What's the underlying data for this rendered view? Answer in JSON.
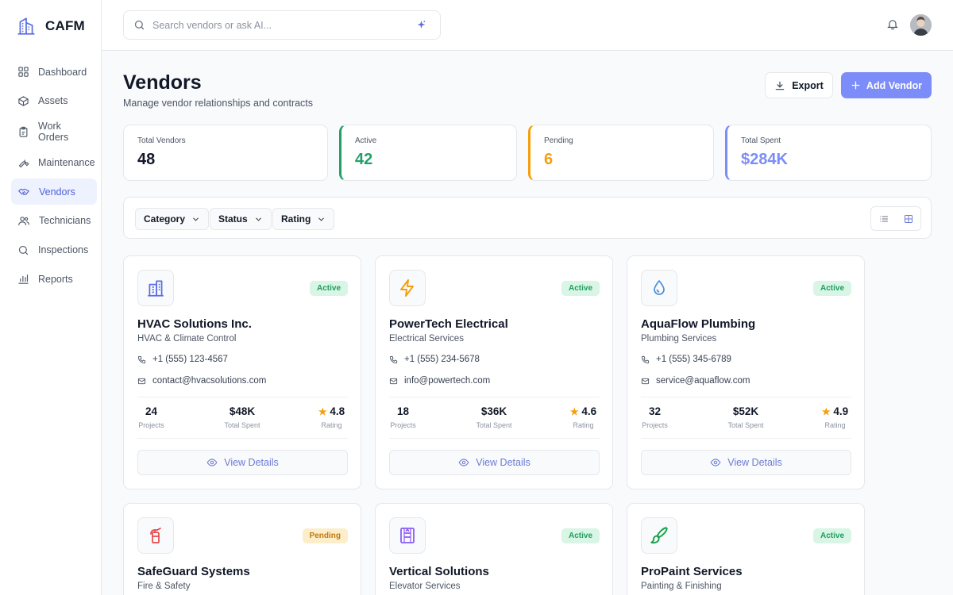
{
  "app": {
    "name": "CAFM"
  },
  "sidebar": {
    "items": [
      {
        "label": "Dashboard"
      },
      {
        "label": "Assets"
      },
      {
        "label": "Work Orders"
      },
      {
        "label": "Maintenance"
      },
      {
        "label": "Vendors"
      },
      {
        "label": "Technicians"
      },
      {
        "label": "Inspections"
      },
      {
        "label": "Reports"
      }
    ]
  },
  "search": {
    "placeholder": "Search vendors or ask AI...",
    "value": ""
  },
  "header": {
    "title": "Vendors",
    "subtitle": "Manage vendor relationships and contracts",
    "export_label": "Export",
    "add_label": "Add Vendor"
  },
  "stats": [
    {
      "label": "Total Vendors",
      "value": "48",
      "color": "#111827"
    },
    {
      "label": "Active",
      "value": "42",
      "color": "#22a06b"
    },
    {
      "label": "Pending",
      "value": "6",
      "color": "#f59e0b"
    },
    {
      "label": "Total Spent",
      "value": "$284K",
      "color": "#7c8cf8"
    }
  ],
  "filters": {
    "category": "Category",
    "status": "Status",
    "rating": "Rating"
  },
  "metric_labels": {
    "projects": "Projects",
    "spent": "Total Spent",
    "rating": "Rating"
  },
  "view_details_label": "View Details",
  "vendors": [
    {
      "name": "HVAC Solutions Inc.",
      "category": "HVAC & Climate Control",
      "status": "Active",
      "phone": "+1 (555) 123-4567",
      "email": "contact@hvacsolutions.com",
      "projects": "24",
      "spent": "$48K",
      "rating": "4.8",
      "icon": "building-icon"
    },
    {
      "name": "PowerTech Electrical",
      "category": "Electrical Services",
      "status": "Active",
      "phone": "+1 (555) 234-5678",
      "email": "info@powertech.com",
      "projects": "18",
      "spent": "$36K",
      "rating": "4.6",
      "icon": "lightning-icon"
    },
    {
      "name": "AquaFlow Plumbing",
      "category": "Plumbing Services",
      "status": "Active",
      "phone": "+1 (555) 345-6789",
      "email": "service@aquaflow.com",
      "projects": "32",
      "spent": "$52K",
      "rating": "4.9",
      "icon": "droplet-icon"
    },
    {
      "name": "SafeGuard Systems",
      "category": "Fire & Safety",
      "status": "Pending",
      "icon": "fire-extinguisher-icon"
    },
    {
      "name": "Vertical Solutions",
      "category": "Elevator Services",
      "status": "Active",
      "icon": "elevator-icon"
    },
    {
      "name": "ProPaint Services",
      "category": "Painting & Finishing",
      "status": "Active",
      "icon": "paintbrush-icon"
    }
  ]
}
